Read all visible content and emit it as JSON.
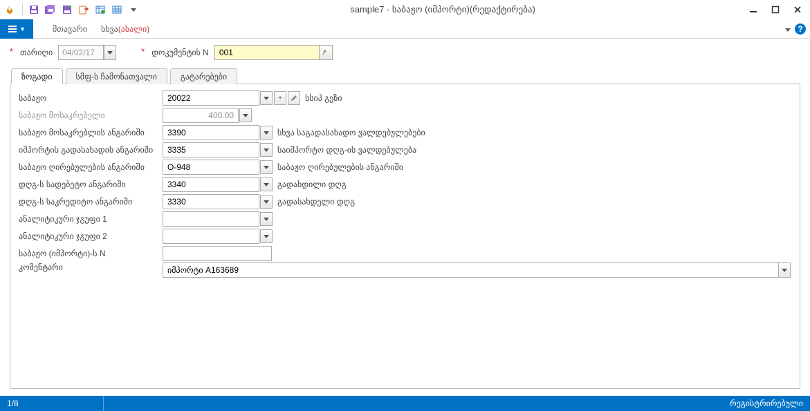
{
  "window": {
    "title": "sample7 - საბაჟო (იმპორტი)(რედაქტირება)"
  },
  "qat": {
    "icons": [
      "flame",
      "save",
      "save-all",
      "save-copy",
      "export",
      "table",
      "grid"
    ],
    "overflow": "▾"
  },
  "ribbon": {
    "tab1": "მთავარი",
    "tab2_a": "სხვა",
    "tab2_b": "(ახალი)"
  },
  "header": {
    "date_label": "თარიღი",
    "date_value": "04/02/17",
    "docn_label": "დოკუმენტის N",
    "docn_value": "001"
  },
  "tabs": {
    "general": "ზოგადი",
    "list": "სმფ-ს ჩამონათვალი",
    "trans": "გატარებები"
  },
  "fields": {
    "customs": {
      "label": "საბაჟო",
      "value": "20022",
      "desc": "სსიპ გეზი"
    },
    "fee": {
      "label": "საბაჟო მოსაკრებელი",
      "value": "400.00"
    },
    "fee_acc": {
      "label": "საბაჟო მოსაკრებლის ანგარიში",
      "value": "3390",
      "desc": "სხვა საგადასახადო ვალდებულებები"
    },
    "imp_tax_acc": {
      "label": "იმპორტის გადასახადის ანგარიში",
      "value": "3335",
      "desc": "საიმპორტო დღგ-ის ვალდებულება"
    },
    "val_acc": {
      "label": "საბაჟო ღირებულების ანგარიში",
      "value": "O-948",
      "desc": "საბაჟო ღირებულების ანგარიში"
    },
    "vat_deb": {
      "label": "დღგ-ს სადებეტო ანგარიში",
      "value": "3340",
      "desc": "გადახდილი დღგ"
    },
    "vat_cred": {
      "label": "დღგ-ს საკრედიტო ანგარიში",
      "value": "3330",
      "desc": "გადასახდელი დღგ"
    },
    "an1": {
      "label": "ანალიტიკური ჯგუფი 1",
      "value": ""
    },
    "an2": {
      "label": "ანალიტიკური ჯგუფი 2",
      "value": ""
    },
    "impn": {
      "label": "საბაჟო (იმპორტი)-ს N",
      "value": ""
    },
    "comment": {
      "label": "კომენტარი",
      "value": "იმპორტი A163689"
    }
  },
  "status": {
    "pager": "1/8",
    "right": "რეგისტრირებული"
  }
}
